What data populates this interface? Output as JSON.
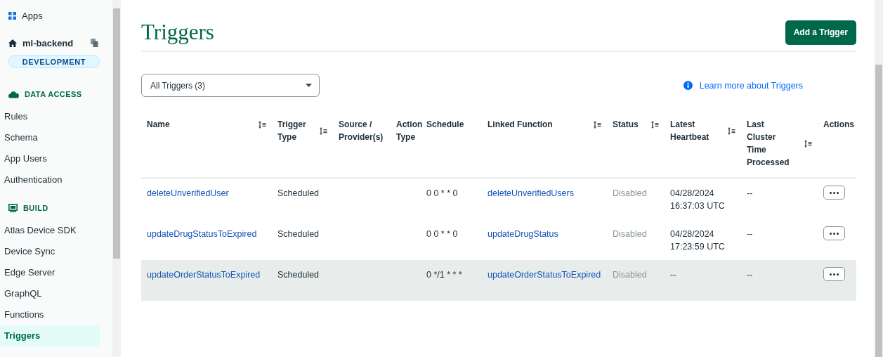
{
  "sidebar": {
    "apps_link": "Apps",
    "app_name": "ml-backend",
    "environment": "DEVELOPMENT",
    "sections": [
      {
        "kind": "data",
        "title": "DATA ACCESS",
        "items": [
          {
            "label": "Rules",
            "selected": false
          },
          {
            "label": "Schema",
            "selected": false
          },
          {
            "label": "App Users",
            "selected": false
          },
          {
            "label": "Authentication",
            "selected": false
          }
        ]
      },
      {
        "kind": "build",
        "title": "BUILD",
        "items": [
          {
            "label": "Atlas Device SDK",
            "selected": false
          },
          {
            "label": "Device Sync",
            "selected": false
          },
          {
            "label": "Edge Server",
            "selected": false
          },
          {
            "label": "GraphQL",
            "selected": false
          },
          {
            "label": "Functions",
            "selected": false
          },
          {
            "label": "Triggers",
            "selected": true
          }
        ]
      }
    ]
  },
  "page": {
    "title": "Triggers",
    "add_button": "Add a Trigger",
    "filter": {
      "value": "All Triggers (3)"
    },
    "learn_link": "Learn more about Triggers"
  },
  "table": {
    "columns": [
      {
        "label": "Name",
        "sortable": true
      },
      {
        "label": "Trigger Type",
        "sortable": true
      },
      {
        "label": "Source / Provider(s)",
        "sortable": false
      },
      {
        "label": "Action Type",
        "sortable": false
      },
      {
        "label": "Schedule",
        "sortable": false
      },
      {
        "label": "Linked Function",
        "sortable": true
      },
      {
        "label": "Status",
        "sortable": true
      },
      {
        "label": "Latest Heartbeat",
        "sortable": true
      },
      {
        "label": "Last Cluster Time Processed",
        "sortable": true
      },
      {
        "label": "Actions",
        "sortable": false
      }
    ],
    "rows": [
      {
        "name": "deleteUnverifiedUser",
        "trigger_type": "Scheduled",
        "schedule": "0 0 * * 0",
        "linked_function": "deleteUnverifiedUsers",
        "status": "Disabled",
        "enabled": false,
        "latest_heartbeat": "04/28/2024 16:37:03 UTC",
        "last_cluster_time": "--",
        "highlighted": false
      },
      {
        "name": "updateDrugStatusToExpired",
        "trigger_type": "Scheduled",
        "schedule": "0 0 * * 0",
        "linked_function": "updateDrugStatus",
        "status": "Disabled",
        "enabled": false,
        "latest_heartbeat": "04/28/2024 17:23:59 UTC",
        "last_cluster_time": "--",
        "highlighted": false
      },
      {
        "name": "updateOrderStatusToExpired",
        "trigger_type": "Scheduled",
        "schedule": "0 */1 * * *",
        "linked_function": "updateOrderStatusToExpired",
        "status": "Disabled",
        "enabled": false,
        "latest_heartbeat": "--",
        "last_cluster_time": "--",
        "highlighted": true
      }
    ]
  }
}
